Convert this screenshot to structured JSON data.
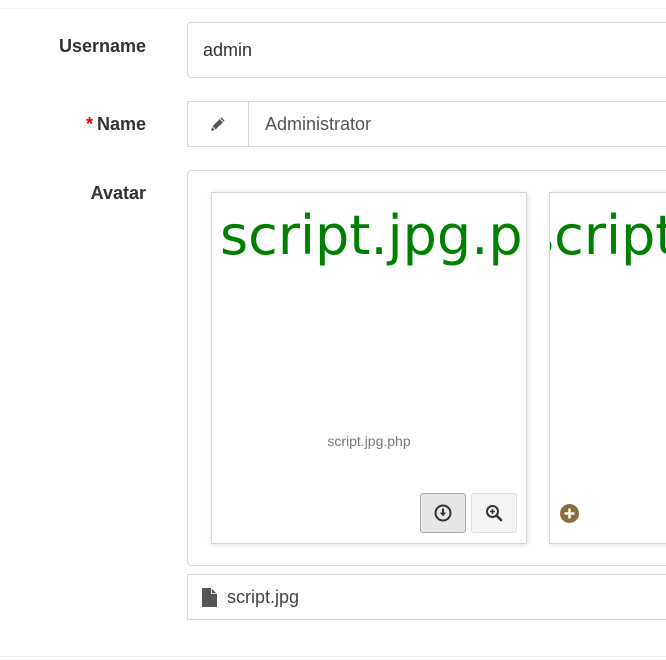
{
  "form": {
    "username": {
      "label": "Username",
      "value": "admin"
    },
    "name": {
      "required_mark": "*",
      "label": "Name",
      "addon_icon": "pencil-icon",
      "value": "Administrator"
    },
    "avatar": {
      "label": "Avatar",
      "previews": [
        {
          "image_text": "script.jpg.php",
          "caption": "script.jpg.php",
          "actions": [
            "download-icon",
            "zoom-in-icon"
          ]
        },
        {
          "image_text": "script",
          "action": "plus-circle-icon"
        }
      ],
      "file_caption": {
        "icon": "file-icon",
        "name": "script.jpg"
      }
    }
  },
  "colors": {
    "preview_text": "#008000",
    "required": "#dd0000",
    "add_button": "#8a6d3b",
    "border": "#d2d6de"
  }
}
